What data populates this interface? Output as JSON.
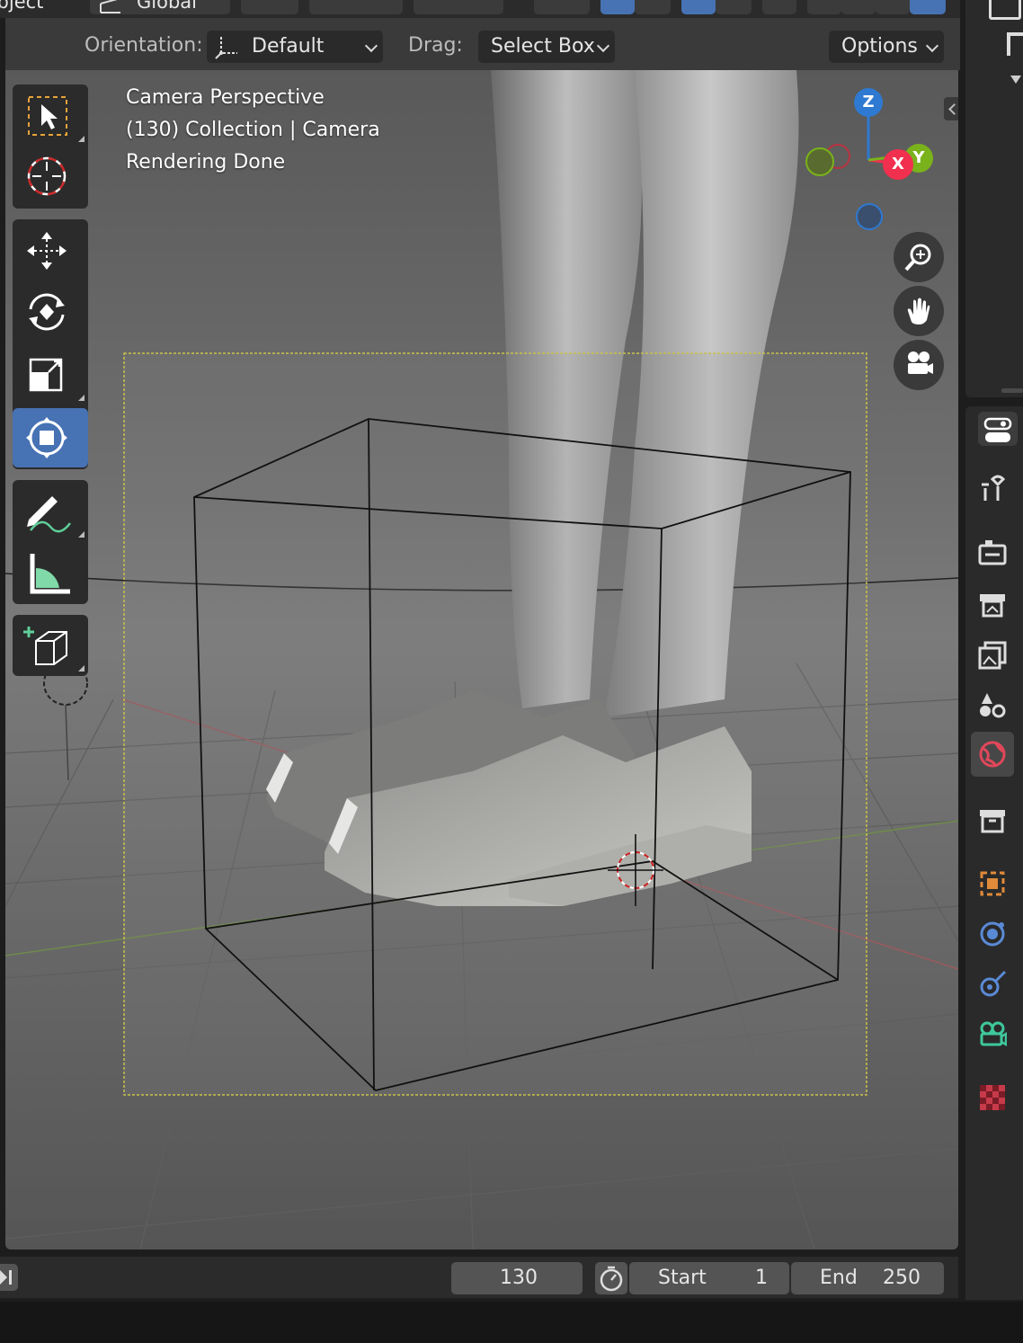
{
  "header_partial": {
    "mode_label": "Object",
    "transform_orientation_label": "Global"
  },
  "tool_settings": {
    "orientation_label": "Orientation:",
    "orientation_value": "Default",
    "drag_label": "Drag:",
    "drag_value": "Select Box",
    "options_label": "Options"
  },
  "viewport": {
    "overlay_lines": [
      "Camera Perspective",
      "(130) Collection | Camera",
      "Rendering Done"
    ]
  },
  "toolbar": {
    "tools": [
      "select-box",
      "cursor",
      "move",
      "rotate",
      "scale",
      "transform",
      "annotate",
      "measure",
      "add-cube"
    ],
    "active_tool": "transform"
  },
  "gizmo": {
    "axes": {
      "x": "X",
      "y": "Y",
      "z": "Z"
    },
    "colors": {
      "x": "#f0304e",
      "y": "#7ab21c",
      "z": "#2e79d1"
    }
  },
  "properties_tabs": [
    "tool",
    "render",
    "output",
    "view-layer",
    "scene",
    "world",
    "collection",
    "object",
    "physics",
    "constraints",
    "data",
    "texture"
  ],
  "active_properties_tab": "world",
  "timeline": {
    "current_frame": "130",
    "start_label": "Start",
    "start_value": "1",
    "end_label": "End",
    "end_value": "250"
  },
  "colors": {
    "accent_blue": "#4772b3",
    "camera_frame": "#c9c24a",
    "panel_dark": "#2b2b2b"
  }
}
